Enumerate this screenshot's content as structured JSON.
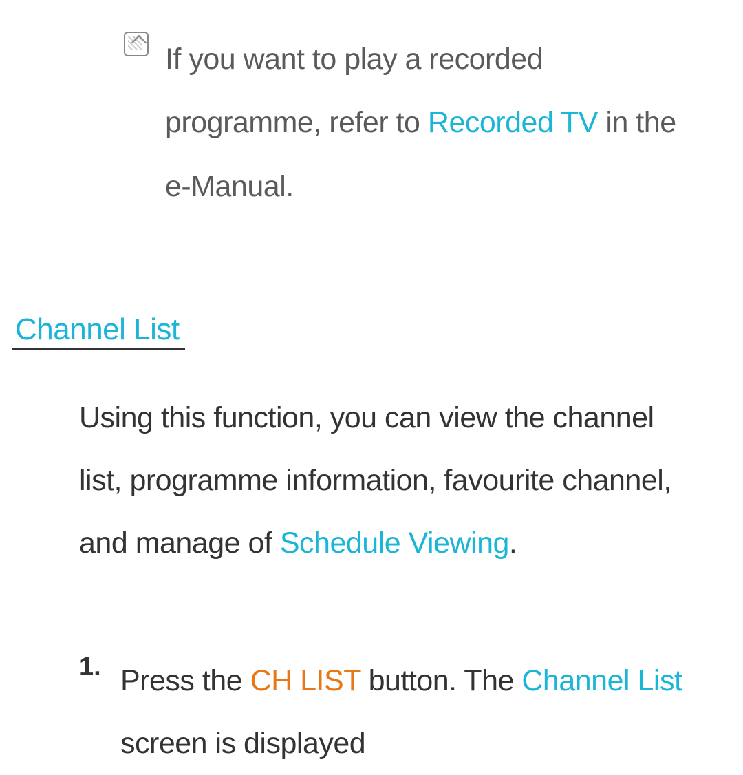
{
  "note": {
    "text_before_link": "If you want to play a recorded programme, refer to ",
    "link_text": "Recorded TV",
    "text_after_link": " in the e-Manual."
  },
  "heading": "Channel List",
  "description": {
    "text_before_link": "Using this function, you can view the channel list, programme information, favourite channel, and manage of ",
    "link_text": "Schedule Viewing",
    "text_after_link": "."
  },
  "step1": {
    "number": "1.",
    "text_before_orange": "Press the ",
    "orange_text": "CH LIST",
    "text_after_orange": " button. The ",
    "link_text": "Channel List",
    "text_after_link": " screen is displayed"
  }
}
